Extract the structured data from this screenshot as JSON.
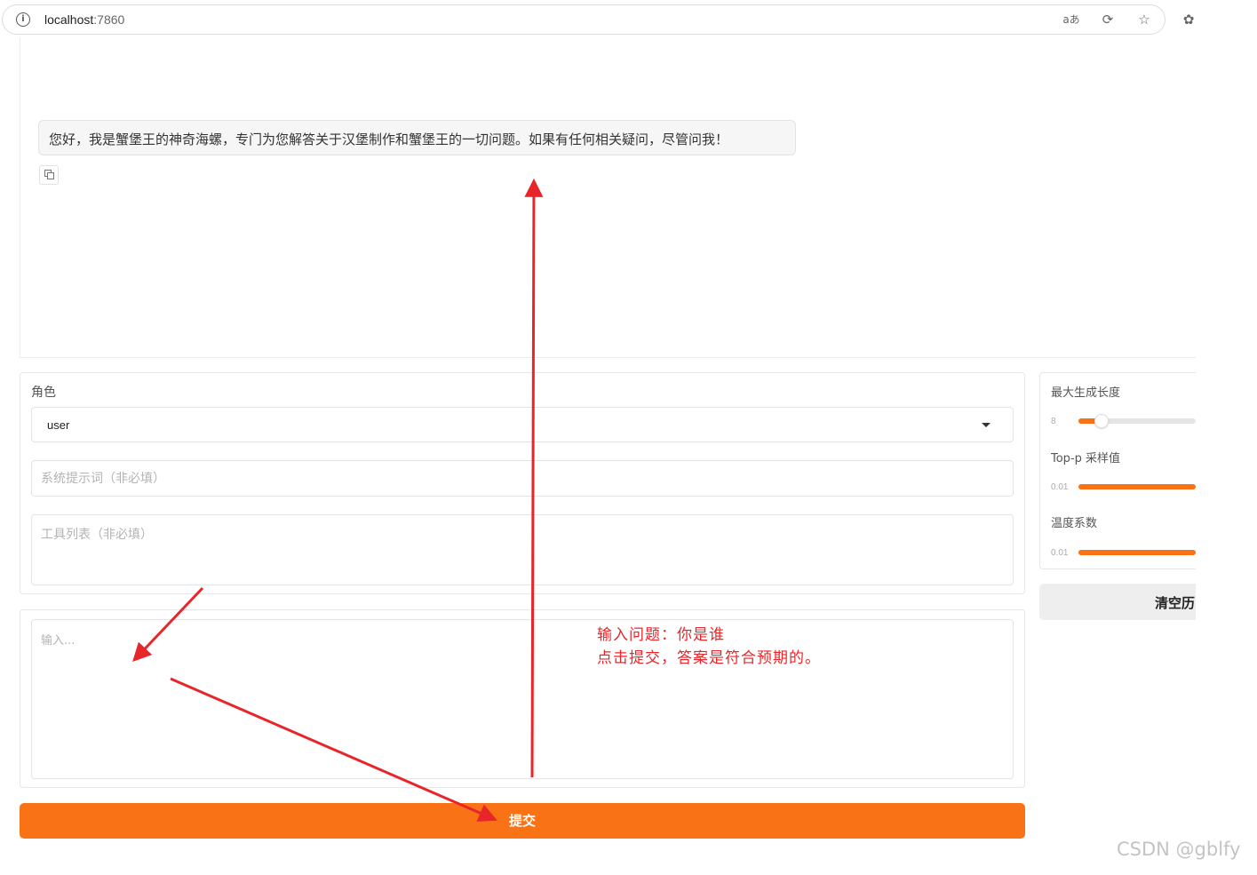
{
  "browser": {
    "url_host": "localhost",
    "url_port": ":7860",
    "info_icon": "i",
    "icons": [
      "translate-icon",
      "refresh-icon",
      "star-icon",
      "extension-icon"
    ],
    "icon_glyphs": {
      "translate": "aあ",
      "refresh": "⟳",
      "star": "☆",
      "extension": "✿"
    }
  },
  "chat": {
    "messages": [
      {
        "role": "assistant",
        "text": "您好，我是蟹堡王的神奇海螺，专门为您解答关于汉堡制作和蟹堡王的一切问题。如果有任何相关疑问，尽管问我！"
      }
    ]
  },
  "config": {
    "role_label": "角色",
    "role_value": "user",
    "system_prompt_placeholder": "系统提示词（非必填）",
    "tools_placeholder": "工具列表（非必填）"
  },
  "input": {
    "placeholder": "输入..."
  },
  "submit_label": "提交",
  "params": {
    "max_length": {
      "label": "最大生成长度",
      "min_label": "8",
      "fraction": 0.2
    },
    "top_p": {
      "label": "Top-p 采样值",
      "min_label": "0.01",
      "fraction": 1.0
    },
    "temperature": {
      "label": "温度系数",
      "min_label": "0.01",
      "fraction": 1.0
    }
  },
  "clear_label": "清空历",
  "annotation": {
    "line1": "输入问题：你是谁",
    "line2": "点击提交，答案是符合预期的。",
    "color": "#e8262a"
  },
  "watermark": "CSDN @gblfy",
  "accent_color": "#f97316"
}
